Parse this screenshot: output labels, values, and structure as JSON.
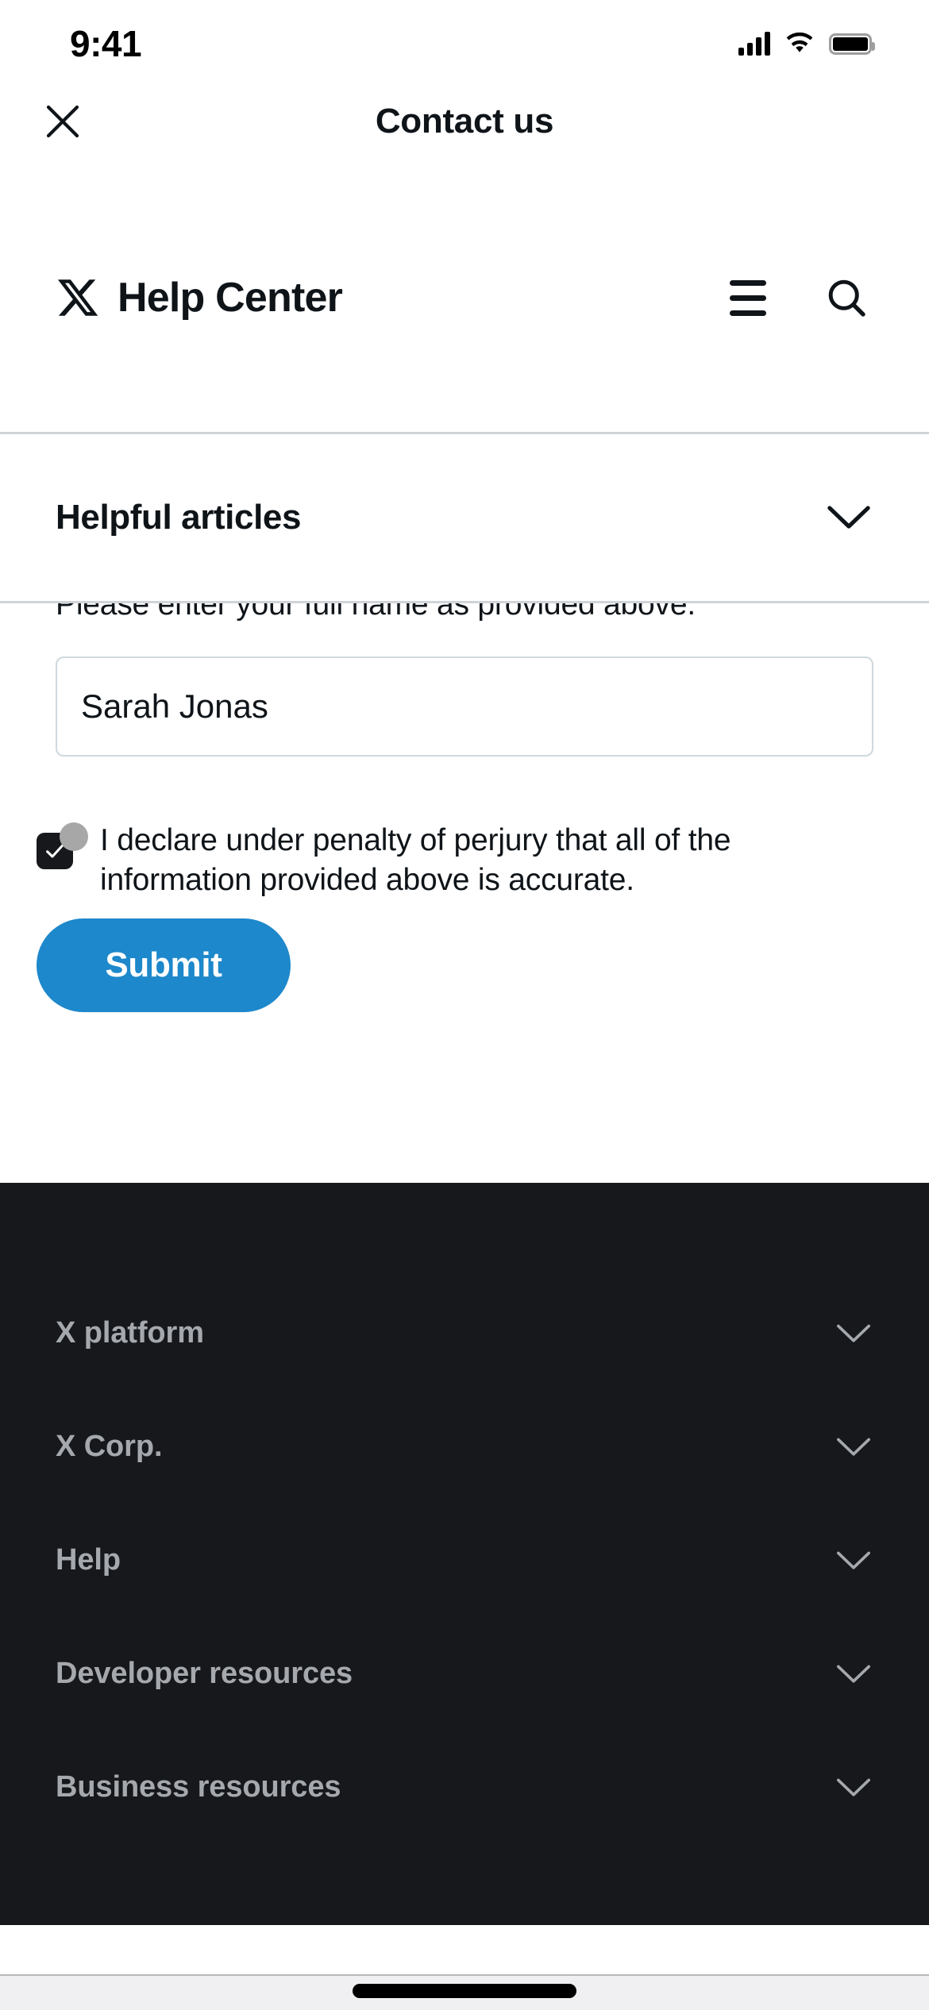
{
  "status_bar": {
    "time": "9:41",
    "cellular_icon": "signal-bars-icon",
    "wifi_icon": "wifi-icon",
    "battery_icon": "battery-icon"
  },
  "nav": {
    "title": "Contact us",
    "close_icon": "close-icon"
  },
  "help_center_header": {
    "logo_icon": "x-logo-icon",
    "title": "Help Center",
    "menu_icon": "hamburger-menu-icon",
    "search_icon": "search-icon"
  },
  "articles_section": {
    "label": "Helpful articles",
    "chevron_icon": "chevron-down-icon"
  },
  "form": {
    "name_help_text": "Please enter your full name as provided above.",
    "name_value": "Sarah Jonas",
    "name_placeholder": "",
    "declaration_text": "I declare under penalty of perjury that all of the information provided above is accurate.",
    "declaration_checked": true,
    "checkbox_check_icon": "checkmark-icon",
    "submit_label": "Submit"
  },
  "footer": {
    "items": [
      {
        "label": "X platform",
        "chevron_icon": "chevron-down-icon"
      },
      {
        "label": "X Corp.",
        "chevron_icon": "chevron-down-icon"
      },
      {
        "label": "Help",
        "chevron_icon": "chevron-down-icon"
      },
      {
        "label": "Developer resources",
        "chevron_icon": "chevron-down-icon"
      },
      {
        "label": "Business resources",
        "chevron_icon": "chevron-down-icon"
      }
    ]
  },
  "colors": {
    "accent_blue": "#1d88cb",
    "text_primary": "#0f1419",
    "footer_bg": "#16181c",
    "footer_text": "#a5a9ad",
    "checkbox_bg": "#17181c",
    "cursor_dot": "#a7a7a7",
    "divider": "#cfd4d9"
  }
}
